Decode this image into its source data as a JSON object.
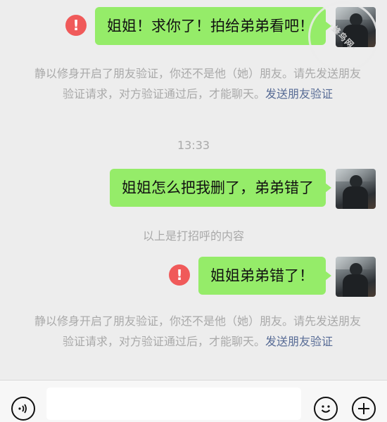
{
  "messages": [
    {
      "text": "姐姐！求你了！拍给弟弟看吧！",
      "failed": true
    },
    {
      "text": "姐姐怎么把我删了，弟弟错了",
      "failed": false
    },
    {
      "text": "姐姐弟弟错了！",
      "failed": true
    }
  ],
  "system": {
    "notice_text": "静以修身开启了朋友验证，你还不是他（她）朋友。请先发送朋友验证请求，对方验证通过后，才能聊天。",
    "notice_link": "发送朋友验证",
    "time": "13:33",
    "greeting_hint": "以上是打招呼的内容"
  },
  "watermark": "·蜂鸟网·",
  "input_bar": {
    "placeholder": "",
    "left_icon": "voice-icon",
    "emoji_icon": "emoji-icon",
    "plus_icon": "plus-icon"
  },
  "colors": {
    "bubble": "#95ec69",
    "error": "#f05a5a",
    "link": "#576b95",
    "background": "#ededed"
  }
}
